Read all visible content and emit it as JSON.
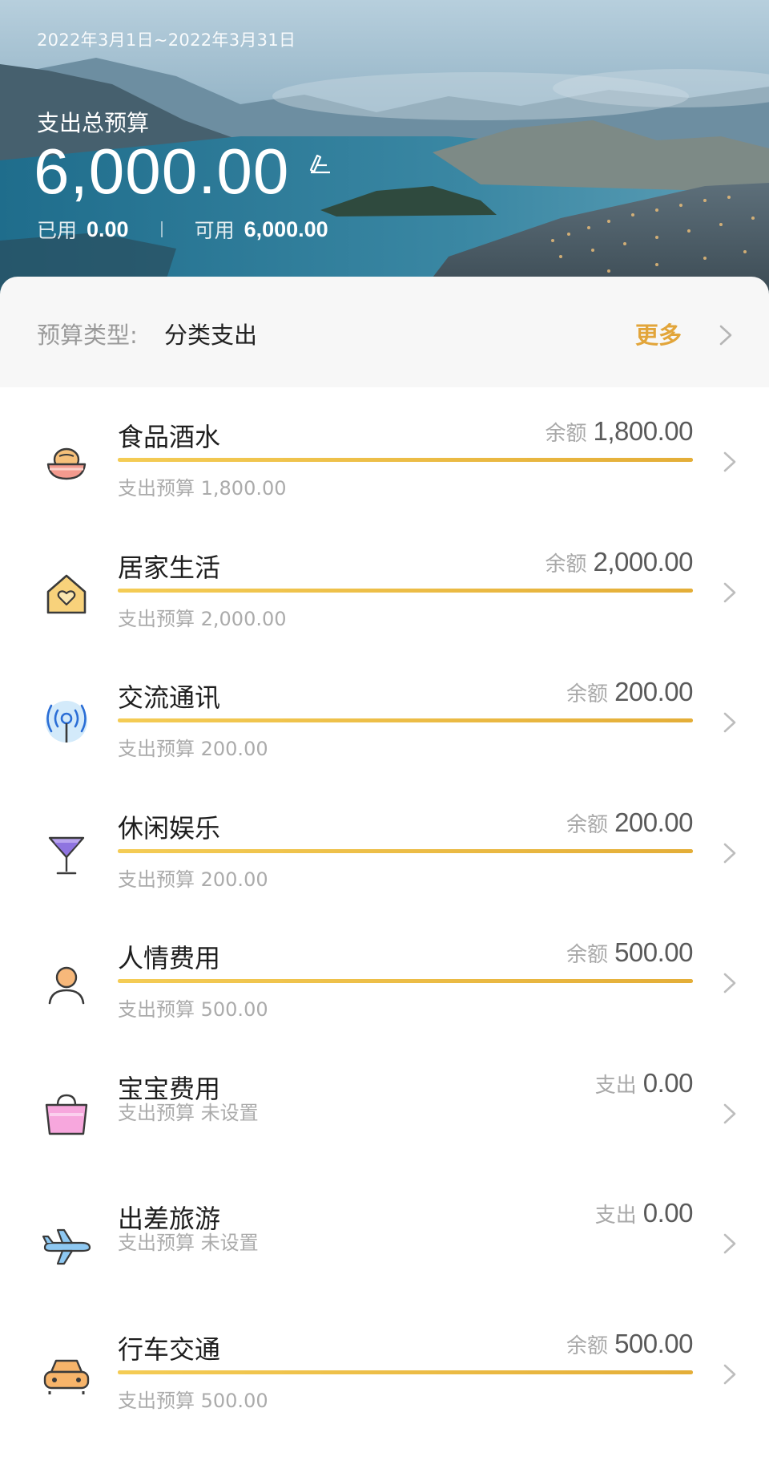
{
  "header": {
    "period": "2022年3月1日~2022年3月31日",
    "total_label": "支出总预算",
    "total_amount": "6,000.00",
    "used_label": "已用",
    "used_value": "0.00",
    "available_label": "可用",
    "available_value": "6,000.00",
    "edit_icon": "edit-icon"
  },
  "budget_type": {
    "label": "预算类型:",
    "value": "分类支出",
    "more_label": "更多",
    "more_color": "#e2a53a"
  },
  "accent_color": "#e8b53e",
  "categories": [
    {
      "name": "食品酒水",
      "right_label": "余额",
      "right_value": "1,800.00",
      "sub": "支出预算 1,800.00",
      "remaining_ratio": 1.0,
      "icon": "food-basket-icon"
    },
    {
      "name": "居家生活",
      "right_label": "余额",
      "right_value": "2,000.00",
      "sub": "支出预算 2,000.00",
      "remaining_ratio": 1.0,
      "icon": "home-heart-icon"
    },
    {
      "name": "交流通讯",
      "right_label": "余额",
      "right_value": "200.00",
      "sub": "支出预算 200.00",
      "remaining_ratio": 1.0,
      "icon": "signal-antenna-icon"
    },
    {
      "name": "休闲娱乐",
      "right_label": "余额",
      "right_value": "200.00",
      "sub": "支出预算 200.00",
      "remaining_ratio": 1.0,
      "icon": "cocktail-glass-icon"
    },
    {
      "name": "人情费用",
      "right_label": "余额",
      "right_value": "500.00",
      "sub": "支出预算 500.00",
      "remaining_ratio": 1.0,
      "icon": "person-icon"
    },
    {
      "name": "宝宝费用",
      "right_label": "支出",
      "right_value": "0.00",
      "sub": "支出预算 未设置",
      "remaining_ratio": null,
      "icon": "shopping-bag-icon"
    },
    {
      "name": "出差旅游",
      "right_label": "支出",
      "right_value": "0.00",
      "sub": "支出预算 未设置",
      "remaining_ratio": null,
      "icon": "airplane-icon"
    },
    {
      "name": "行车交通",
      "right_label": "余额",
      "right_value": "500.00",
      "sub": "支出预算 500.00",
      "remaining_ratio": 1.0,
      "icon": "car-icon"
    }
  ]
}
